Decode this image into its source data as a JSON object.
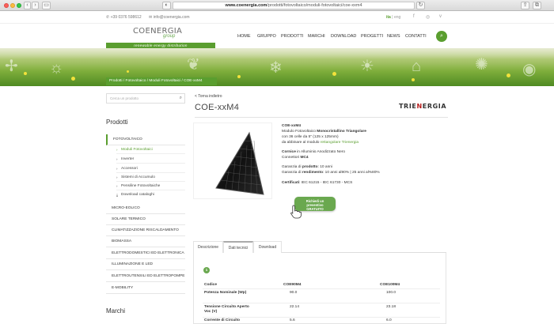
{
  "browser": {
    "url_domain": "www.coenergia.com",
    "url_path": "/prodotti/fotovoltaico/moduli-fotovoltaici/coe-xxm4"
  },
  "topbar": {
    "phone": "+39 0376 598612",
    "email": "info@coenergia.com",
    "lang_active": "ita",
    "lang_sep": "|",
    "lang_other": "eng"
  },
  "header": {
    "logo_text": "COENERGIA",
    "logo_group": "group",
    "tagline": "renewable energy distribution",
    "nav": [
      "HOME",
      "GRUPPO",
      "PRODOTTI",
      "MARCHI",
      "DOWNLOAD",
      "PROGETTI",
      "NEWS",
      "CONTATTI"
    ]
  },
  "breadcrumb": {
    "text": "Prodotti  /  Fotovoltaico  /  Moduli Fotovoltaici  /  COE-xxM4"
  },
  "sidebar": {
    "search_placeholder": "Cerca un prodotto",
    "heading": "Prodotti",
    "main_open": "FOTOVOLTAICO",
    "sub_items": [
      "Moduli Fotovoltaici",
      "Inverter",
      "Accessori",
      "Sistemi di Accumulo",
      "Pensiline Fotovoltaiche",
      "Download cataloghi"
    ],
    "other_items": [
      "MICRO-EOLICO",
      "SOLARE TERMICO",
      "CLIMATIZZAZIONE RISCALDAMENTO",
      "BIOMASSA",
      "ELETTRODOMESTICI ED ELETTRONICA",
      "ILLUMINAZIONE E LED",
      "ELETTROUTENSILI ED ELETTROPOMPE",
      "E-MOBILITY"
    ],
    "heading2": "Marchi"
  },
  "main": {
    "back": "< Torna indietro",
    "title": "COE-xxM4",
    "brand_pre": "TRIE",
    "brand_n": "N",
    "brand_post": "ERGIA",
    "desc": {
      "code": "COE-xxM4",
      "line1_pre": "Modulo Fotovoltaico ",
      "line1_bold": "Monocristallino Triangolare",
      "line2": "con 36 celle da 5\" (125 x 125mm)",
      "line3_pre": "da abbinare al modulo ",
      "line3_green": "rettangolare Trienergia",
      "cornice_bold": "Cornice",
      "cornice_rest": " in Alluminio Anodizzato Nero",
      "conn_pre": "Connettori ",
      "conn_bold": "MC4",
      "gar1_pre": "Garanzia di ",
      "gar1_bold": "prodotto",
      "gar1_rest": ": 10 anni",
      "gar2_pre": "Garanzia di ",
      "gar2_bold": "rendimento",
      "gar2_rest": ": 10 anni al90%  |  25 anni al%80%",
      "cert_bold": "Certificati",
      "cert_rest": ": IEC 61215 - IEC 61730 - MCS"
    },
    "cta_line1": "Richiedi un",
    "cta_line2": "preventivo",
    "cta_line3": "GRATUITO",
    "tabs": [
      "Descrizione",
      "Dati tecnici",
      "Download"
    ],
    "badge": "1",
    "table": {
      "headers": [
        "Codice",
        "COE90M4",
        "COE100M4"
      ],
      "rows": [
        {
          "label": "Potenza Nominale (Wp)",
          "v1": "90.0",
          "v2": "100.0"
        },
        {
          "label": "Tensione Circuito Aperto Voc (V)",
          "v1": "22.14",
          "v2": "23.18"
        },
        {
          "label": "Corrente di Circuito",
          "v1": "5.6",
          "v2": "6.0"
        }
      ]
    }
  }
}
